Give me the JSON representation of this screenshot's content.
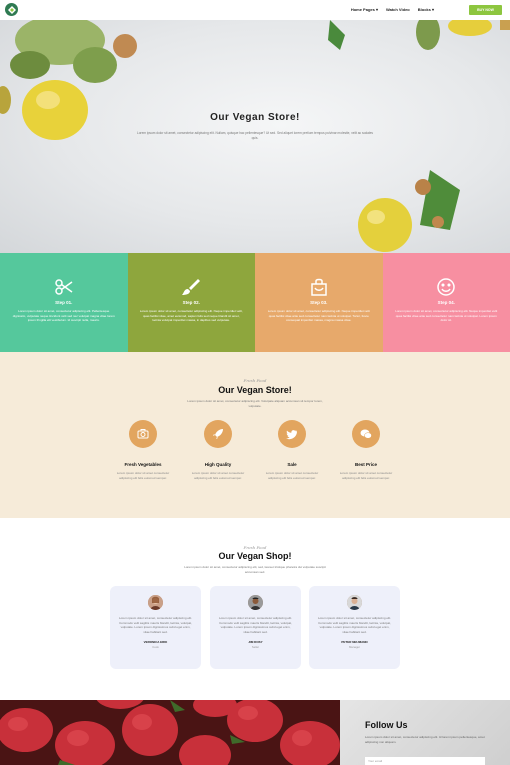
{
  "nav": {
    "links": [
      "Home Pages ▾",
      "Watch Video",
      "Blocks ▾"
    ],
    "buy_label": "BUY NOW"
  },
  "hero": {
    "title": "Our Vegan Store!",
    "text": "Lorem ipsum dolor sit amet, consectetur adipiscing elit. Nullam, quisque hac pellentesque? Ut sed. Sed aliquet lorem pretium tempus pulvinar molestie, velit ac sodales quis."
  },
  "steps": [
    {
      "title": "Step 01.",
      "text": "Lorem ipsum dolor sit amet, consectetur adipiscing elit. Pellentesque dignissim, vulputate neque tincidunt velit sed nec volutpat magna vitae lorem ipsum fringilla elit vestibulum. Id suscipit nulla, mauris.",
      "color": "#55c89c",
      "icon": "scissors-icon"
    },
    {
      "title": "Step 02.",
      "text": "Lorem ipsum dolor sit amet, consectetur adipiscing elit. Neque imperdiet velit, quas facilisi vitae, amet euismod, sapien felis sed neque blandit sit amet, lacinia volutpat imperdiet massa, in dapibus sed vulputate.",
      "color": "#8ea63d",
      "icon": "brush-icon"
    },
    {
      "title": "Step 03.",
      "text": "Lorem ipsum dolor sit amet, consectetur adipiscing elit. Neque imperdiet velit quas facilisi vitae ante sed consectetur nam lacinia ut volutpat. Tortor, fusce consequat imperdiet massa, magna massa vitae.",
      "color": "#e7a96b",
      "icon": "bag-icon"
    },
    {
      "title": "Step 04.",
      "text": "Lorem ipsum dolor sit amet, consectetur adipiscing elit. Neque imperdiet velit quas facilisi vitae ante sed consectetur nam lacinia ut volutpat. Lorem ipsum dolor sit.",
      "color": "#f78fa1",
      "icon": "smile-icon"
    }
  ],
  "features": {
    "subtitle": "Fresh Food",
    "title": "Our Vegan Store!",
    "text": "Lorem ipsum dolor sit amet, consectetur adipiscing elit. Volutpate aliquam accumsan sit tempor lorem, vulputate.",
    "items": [
      {
        "title": "Fresh Vegetables",
        "text": "Lorem ipsum dolor sit amet consectetur adipiscing elit felis euismod semper.",
        "icon": "camera-icon"
      },
      {
        "title": "High Quality",
        "text": "Lorem ipsum dolor sit amet consectetur adipiscing elit felis euismod semper.",
        "icon": "rocket-icon"
      },
      {
        "title": "Sale",
        "text": "Lorem ipsum dolor sit amet consectetur adipiscing elit felis euismod semper.",
        "icon": "twitter-icon"
      },
      {
        "title": "Best Price",
        "text": "Lorem ipsum dolor sit amet consectetur adipiscing elit felis euismod semper.",
        "icon": "chat-icon"
      }
    ]
  },
  "testimonials": {
    "subtitle": "Fresh Food",
    "title": "Our Vegan Shop!",
    "text": "Lorem ipsum dolor sit amet, consectetur adipiscing elit, sed, laoreet tristique pharetra dui vulputate suscipit accumsan sed.",
    "cards": [
      {
        "text": "Lorem ipsum dolor sit amet, consectetur adipiscing elit. Commodo velit sagittis mauris blandit, lacinia, volutpat, vulputate. Lorem ipsum dignissimos subd eget enim, vitae habitant sed.",
        "name": "VERONICA ERIK",
        "role": "Cook"
      },
      {
        "text": "Lorem ipsum dolor sit amet, consectetur adipiscing elit. Commodo velit sagittis mauris blandit, lacinia, volutpat, vulputate. Lorem ipsum dignissimos subd eget enim, vitae habitant sed.",
        "name": "JIM DOSY",
        "role": "Seller"
      },
      {
        "text": "Lorem ipsum dolor sit amet, consectetur adipiscing elit. Commodo velit sagittis mauris blandit, lacinia, volutpat, vulputate. Lorem ipsum dignissimos subd eget enim, vitae habitant sed.",
        "name": "PETER NEUMANN",
        "role": "Manager"
      }
    ]
  },
  "follow": {
    "title": "Follow Us",
    "text": "Lorem ipsum dolor sit amet, consectetur adipiscing elit. Id lorem ipsum pellentesque, amet adipiscing non aliquam.",
    "placeholder": "Your email"
  }
}
